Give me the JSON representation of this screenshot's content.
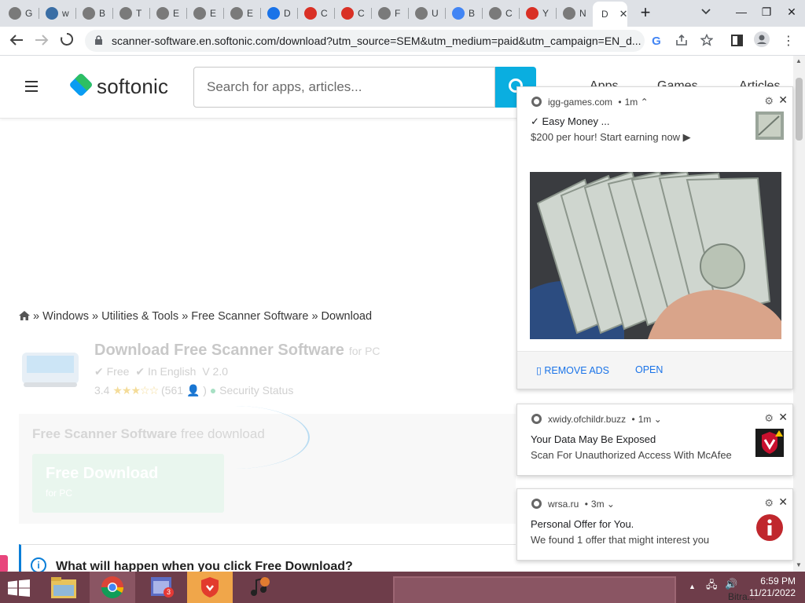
{
  "browser": {
    "tabs": [
      {
        "letter": "G",
        "color": "#7a7a7a"
      },
      {
        "letter": "w",
        "color": "#3a6ea5"
      },
      {
        "letter": "B",
        "color": "#7a7a7a"
      },
      {
        "letter": "T",
        "color": "#7a7a7a"
      },
      {
        "letter": "E",
        "color": "#7a7a7a"
      },
      {
        "letter": "E",
        "color": "#7a7a7a"
      },
      {
        "letter": "E",
        "color": "#7a7a7a"
      },
      {
        "letter": "D",
        "color": "#1a73e8"
      },
      {
        "letter": "C",
        "color": "#d93025"
      },
      {
        "letter": "C",
        "color": "#d93025"
      },
      {
        "letter": "F",
        "color": "#7a7a7a"
      },
      {
        "letter": "U",
        "color": "#7a7a7a"
      },
      {
        "letter": "B",
        "color": "#4285f4"
      },
      {
        "letter": "C",
        "color": "#7a7a7a"
      },
      {
        "letter": "Y",
        "color": "#d93025"
      },
      {
        "letter": "N",
        "color": "#7a7a7a"
      }
    ],
    "active_tab": {
      "letter": "D",
      "close": "✕"
    },
    "new_tab": "+",
    "url": "scanner-software.en.softonic.com/download?utm_source=SEM&utm_medium=paid&utm_campaign=EN_d...",
    "window_controls": {
      "minimize": "—",
      "restore": "❐",
      "close": "✕"
    }
  },
  "site": {
    "logo": "softonic",
    "search_placeholder": "Search for apps, articles...",
    "nav": [
      "Apps",
      "Games",
      "Articles"
    ]
  },
  "breadcrumb": {
    "items": [
      "Windows",
      "Utilities & Tools",
      "Free Scanner Software"
    ],
    "current": "Download",
    "sep": "»"
  },
  "app": {
    "title": "Download Free Scanner Software",
    "platform": "for PC",
    "license": "Free",
    "language": "In English",
    "version": "V 2.0",
    "rating": "3.4",
    "reviews": "(561",
    "security": "Security Status"
  },
  "download": {
    "title_bold": "Free Scanner Software",
    "title_light": "free download",
    "button": "Free Download",
    "button_sub": "for PC"
  },
  "info": {
    "text": "What will happen when you click Free Download?"
  },
  "notifications": [
    {
      "source": "igg-games.com",
      "age": "1m",
      "caret": "⌃",
      "title": "✓ Easy Money ...",
      "body": "$200 per hour! Start earning now ▶",
      "actions": [
        "REMOVE ADS",
        "OPEN"
      ]
    },
    {
      "source": "xwidy.ofchildr.buzz",
      "age": "1m",
      "caret": "⌄",
      "title": "Your Data May Be Exposed",
      "body": "Scan For Unauthorized Access With McAfee"
    },
    {
      "source": "wrsa.ru",
      "age": "3m",
      "caret": "⌄",
      "title": "Personal Offer for You.",
      "body": "We found 1 offer that might interest you"
    }
  ],
  "taskbar": {
    "badge": "3",
    "time": "6:59 PM",
    "date": "11/21/2022",
    "desk_label": "Bitra..."
  }
}
